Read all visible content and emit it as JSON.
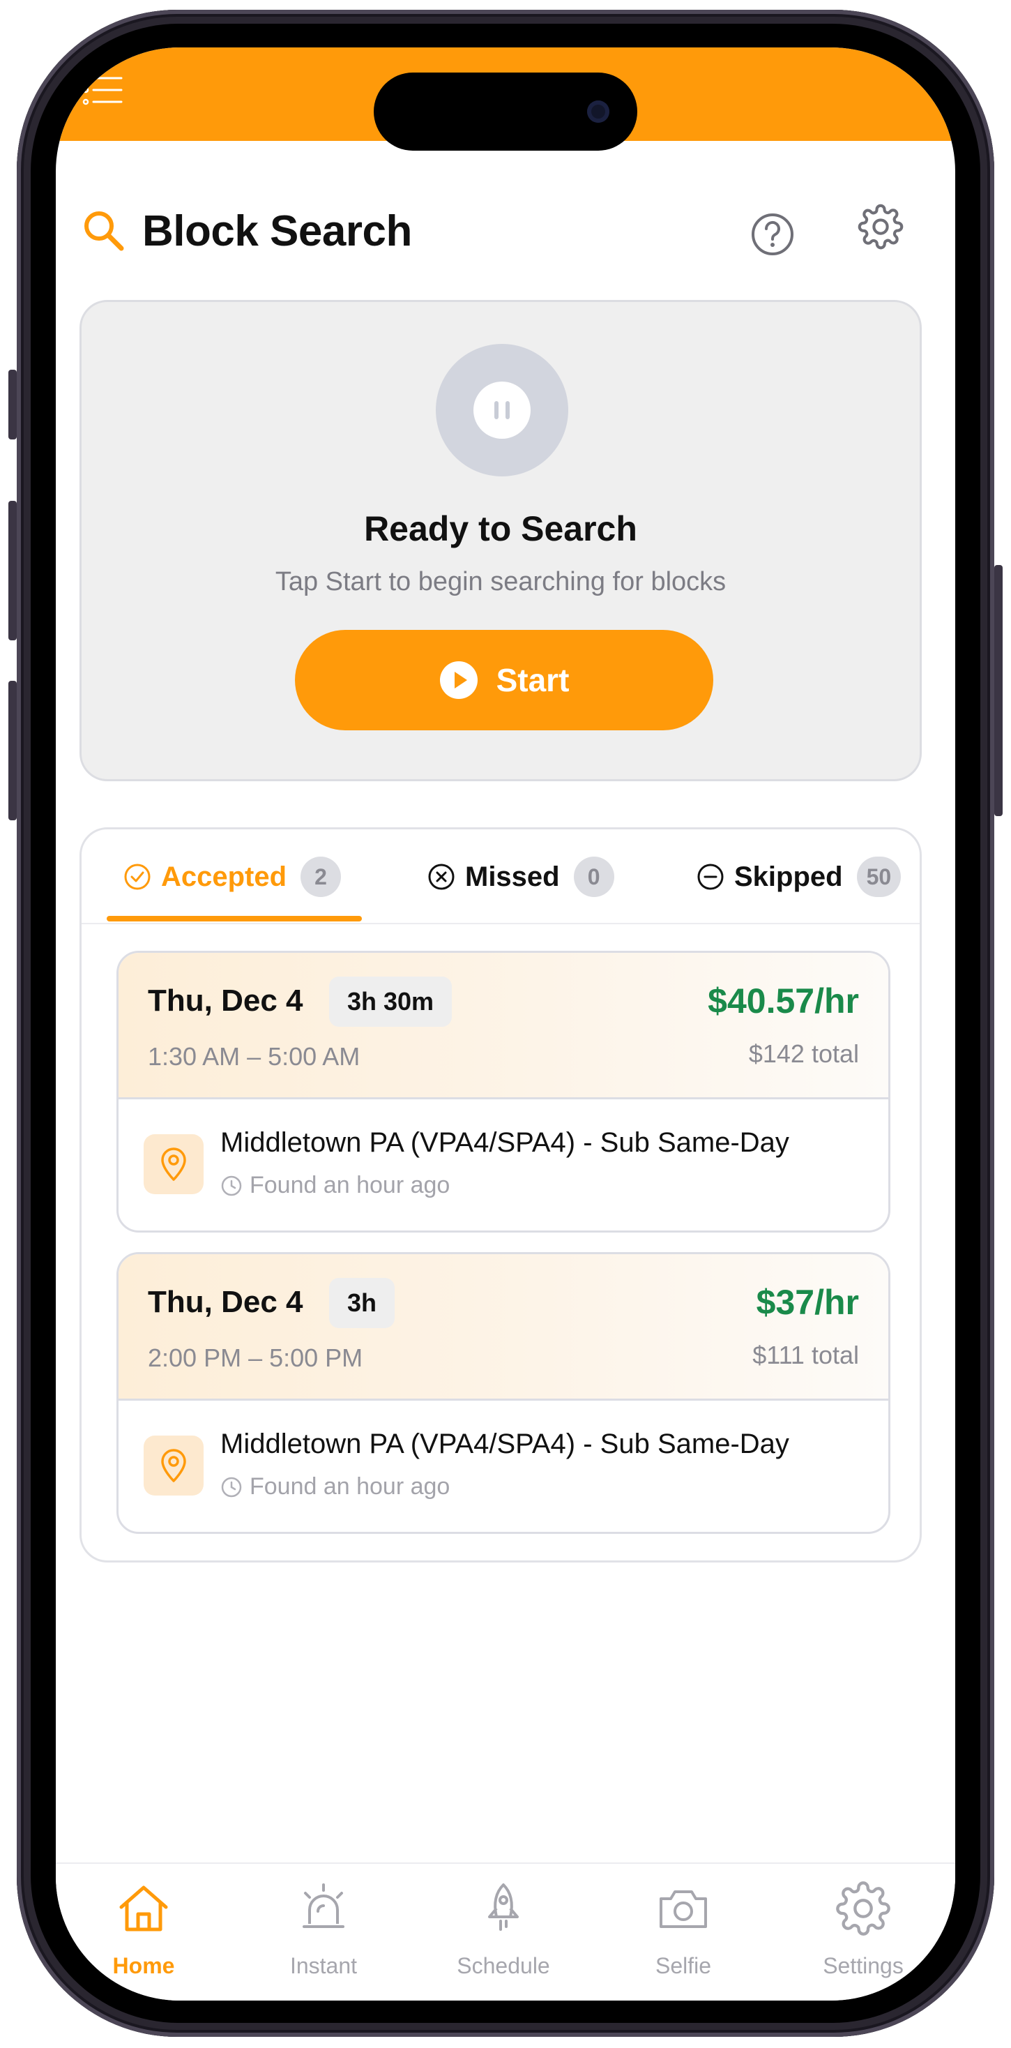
{
  "header": {
    "title": "Block Search"
  },
  "search_card": {
    "status_title": "Ready to Search",
    "status_subtitle": "Tap Start to begin searching for blocks",
    "start_label": "Start"
  },
  "tabs": [
    {
      "label": "Accepted",
      "count": "2",
      "icon": "check-circle-icon",
      "active": true
    },
    {
      "label": "Missed",
      "count": "0",
      "icon": "x-circle-icon",
      "active": false
    },
    {
      "label": "Skipped",
      "count": "50",
      "icon": "minus-circle-icon",
      "active": false
    }
  ],
  "blocks": [
    {
      "date": "Thu, Dec 4",
      "duration": "3h 30m",
      "time_range": "1:30 AM – 5:00 AM",
      "rate": "$40.57/hr",
      "total": "$142 total",
      "location": "Middletown PA (VPA4/SPA4) - Sub Same-Day",
      "found": "Found an hour ago"
    },
    {
      "date": "Thu, Dec 4",
      "duration": "3h",
      "time_range": "2:00 PM – 5:00 PM",
      "rate": "$37/hr",
      "total": "$111 total",
      "location": "Middletown PA (VPA4/SPA4) - Sub Same-Day",
      "found": "Found an hour ago"
    }
  ],
  "nav": [
    {
      "label": "Home",
      "icon": "home-icon",
      "active": true
    },
    {
      "label": "Instant",
      "icon": "siren-icon",
      "active": false
    },
    {
      "label": "Schedule",
      "icon": "rocket-icon",
      "active": false
    },
    {
      "label": "Selfie",
      "icon": "camera-icon",
      "active": false
    },
    {
      "label": "Settings",
      "icon": "gear-icon",
      "active": false
    }
  ],
  "colors": {
    "accent": "#ff9a0a",
    "rate_green": "#1a8a4a",
    "muted_text": "#8a8a92"
  }
}
